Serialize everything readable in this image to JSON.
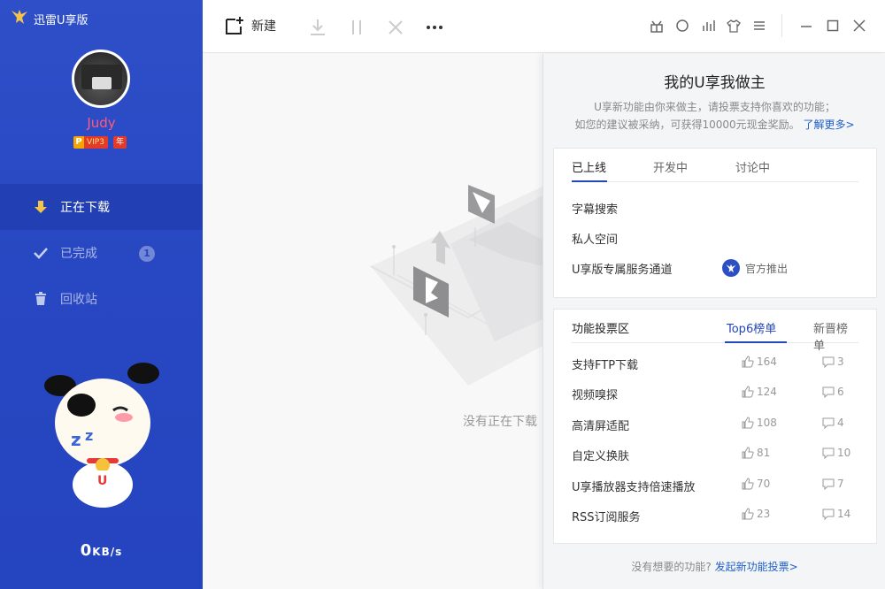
{
  "app": {
    "name": "迅雷U享版"
  },
  "user": {
    "name": "Judy",
    "vip_label": "VIP3",
    "vip_p": "P",
    "year_label": "年"
  },
  "sidebar": {
    "items": [
      {
        "label": "正在下载",
        "icon": "download-arrow-icon"
      },
      {
        "label": "已完成",
        "icon": "check-icon",
        "count": "1"
      },
      {
        "label": "回收站",
        "icon": "trash-icon"
      }
    ],
    "speed_value": "0",
    "speed_unit": "KB/s"
  },
  "toolbar": {
    "new_label": "新建"
  },
  "main": {
    "empty_text": "没有正在下载"
  },
  "panel": {
    "title": "我的U享我做主",
    "desc_line1": "U享新功能由你来做主，请投票支持你喜欢的功能；",
    "desc_line2": "如您的建议被采纳，可获得10000元现金奖励。",
    "learn_more": "了解更多>",
    "card1": {
      "tabs": [
        "已上线",
        "开发中",
        "讨论中"
      ],
      "features": [
        "字幕搜索",
        "私人空间",
        "U享版专属服务通道"
      ],
      "official": "官方推出"
    },
    "card2": {
      "tabs": [
        "功能投票区",
        "Top6榜单",
        "新晋榜单"
      ],
      "rows": [
        {
          "name": "支持FTP下载",
          "likes": "164",
          "comments": "3"
        },
        {
          "name": "视频嗅探",
          "likes": "124",
          "comments": "6"
        },
        {
          "name": "高清屏适配",
          "likes": "108",
          "comments": "4"
        },
        {
          "name": "自定义换肤",
          "likes": "81",
          "comments": "10"
        },
        {
          "name": "U享播放器支持倍速播放",
          "likes": "70",
          "comments": "7"
        },
        {
          "name": "RSS订阅服务",
          "likes": "23",
          "comments": "14"
        }
      ]
    },
    "footer_q": "没有想要的功能?",
    "footer_link": "发起新功能投票>"
  },
  "colors": {
    "sidebar": "#2f4fc9",
    "accent": "#1f5fc8",
    "username": "#ff5b7b"
  }
}
